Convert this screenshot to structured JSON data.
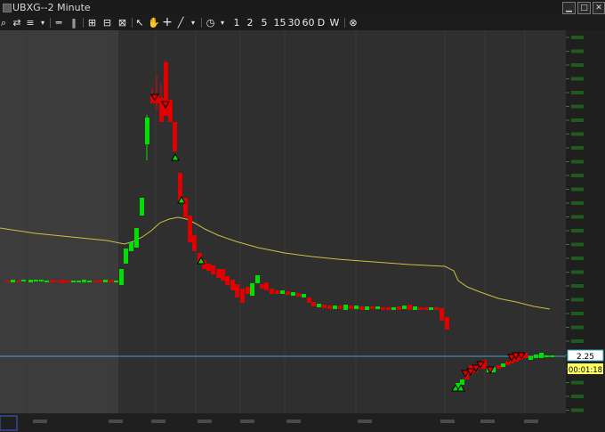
{
  "window": {
    "title": "UBXG--2 Minute"
  },
  "toolbar": {
    "bar_numbers": [
      "1",
      "2",
      "5",
      "15",
      "30",
      "60"
    ],
    "period_letters": [
      "D",
      "W"
    ]
  },
  "chart": {
    "last_price_label": "2.25",
    "countdown_label": "00:01:18",
    "colors": {
      "up": "#00e000",
      "down": "#e00000",
      "ma": "#c8c040",
      "price_line": "#3aa8c8",
      "background": "#2f2f2f",
      "premarket": "#3c3c3c"
    }
  }
}
